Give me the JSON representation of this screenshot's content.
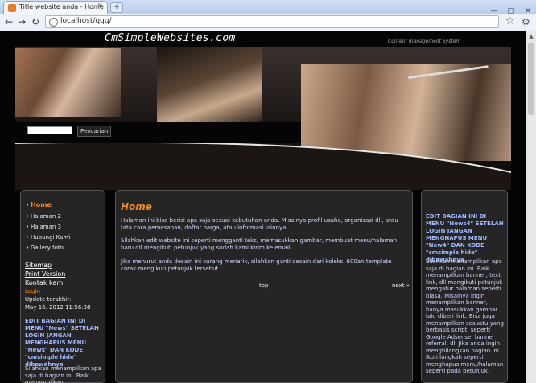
{
  "browser": {
    "tab_title": "Title website anda - Home",
    "url": "localhost/qqq/",
    "new_tab": "+",
    "win_minimize": "—",
    "win_maximize": "□",
    "win_close": "✕"
  },
  "site": {
    "logo": "CmSimpleWebsites.com",
    "tagline": "Content management System",
    "search_button": "Pencarian"
  },
  "menu": {
    "items": [
      {
        "label": "Home"
      },
      {
        "label": "Halaman 2"
      },
      {
        "label": "Halaman 3"
      },
      {
        "label": "Hubungi Kami"
      },
      {
        "label": "Gallery foto"
      }
    ]
  },
  "sidebar": {
    "sitemap": "Sitemap",
    "print": "Print Version",
    "contact": "Kontak kami",
    "login": "Login",
    "updated_label": "Update terakhir:",
    "updated_value": "May 16. 2012 11:56:38",
    "edit_notice": "EDIT BAGIAN INI DI MENU \"News\" SETELAH LOGIN JANGAN MENGHAPUS MENU \"News\" DAN KODE \"cmsimple hide\" dibawahnya",
    "text": "Silahkan menampilkan apa saja di bagian ini. Baik menampilkan"
  },
  "main": {
    "title": "Home",
    "para1": "Halaman ini bisa berisi apa saja sesuai kebutuhan anda. Misalnya profil usaha, organisasi dll, atau tata cara pemesanan, daftar harga, atau informasi lainnya.",
    "para2": "Silahkan edit website ini seperti mengganti teks, memasukkan gambar, membuat menu/halaman baru dll mengikuti petunjuk yang sudah kami kirim ke email.",
    "para3": "Jika menurut anda desain ini kurang menarik, silahkan ganti desain dari koleksi 600an template corak mengikuti petunjuk tersebut.",
    "top": "top",
    "next": "next »"
  },
  "right": {
    "edit_notice": "EDIT BAGIAN INI DI MENU \"News4\" SETELAH LOGIN JANGAN MENGHAPUS MENU \"New4\" DAN KODE \"cmsimple hide\" dibawahnya",
    "text": "Silahkan menampilkan apa saja di bagian ini. Baik menampilkan banner, text link, dll mengikuti petunjuk mengatur halaman seperti biasa. Misalnya ingin menampilkan banner, hanya masukkan gambar lalu diberi link. Bisa juga menampilkan sesuatu yang berbasis script, seperti Google Adsense, banner referral, dll Jika anda ingin menghilangkan bagian ini ikuti langkah seperti menghapus menu/halaman seperti pada petunjuk."
  },
  "colors": {
    "accent": "#f08a1c",
    "link_blue": "#9fb8ff"
  }
}
